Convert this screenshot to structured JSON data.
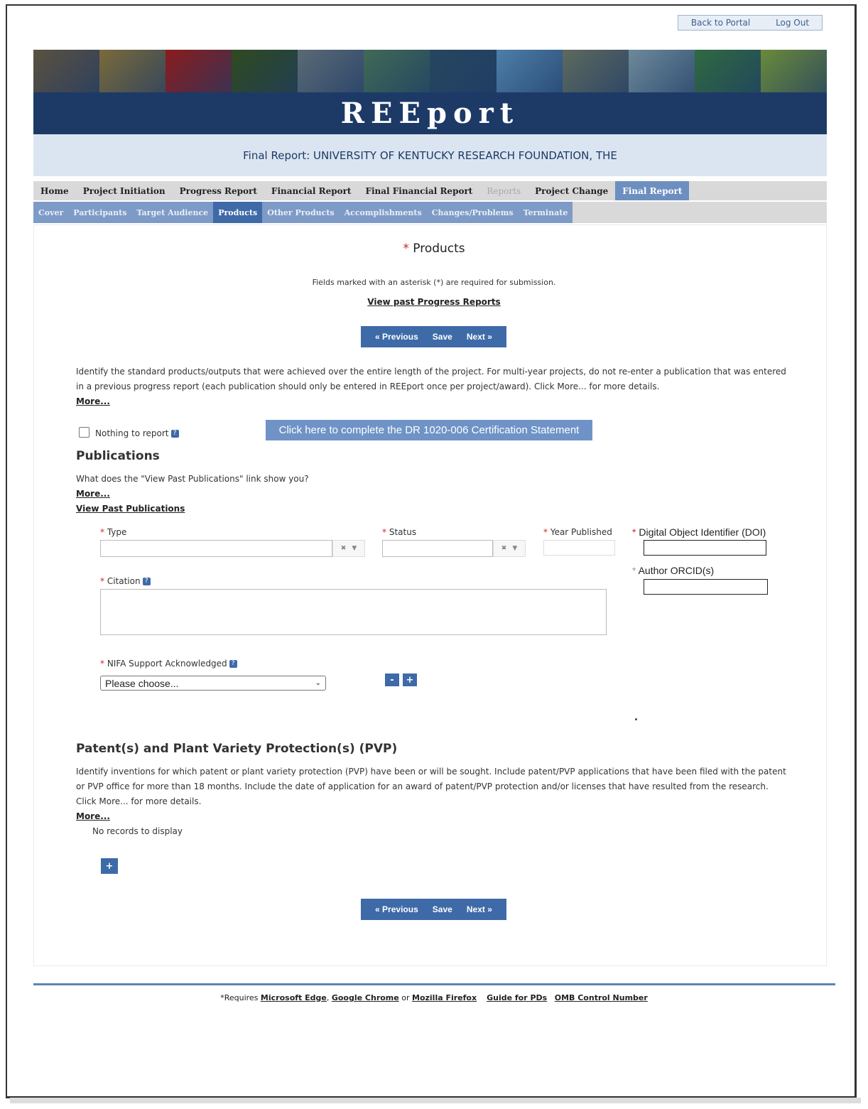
{
  "top_links": {
    "back": "Back to Portal",
    "logout": "Log Out"
  },
  "banner": {
    "title": "REEport",
    "photo_colors": [
      "#5b5140",
      "#7a6a3a",
      "#8a1c1c",
      "#2f4a1e",
      "#5a6a75",
      "#3f6a55",
      "#27465e",
      "#4d7fa8",
      "#5d6a5e",
      "#6d8a9a",
      "#2f6a40",
      "#6a8a3a"
    ]
  },
  "report_header": "Final Report: UNIVERSITY OF KENTUCKY RESEARCH FOUNDATION, THE",
  "nav_main": [
    {
      "label": "Home",
      "state": "normal"
    },
    {
      "label": "Project Initiation",
      "state": "normal"
    },
    {
      "label": "Progress Report",
      "state": "normal"
    },
    {
      "label": "Financial Report",
      "state": "normal"
    },
    {
      "label": "Final Financial Report",
      "state": "normal"
    },
    {
      "label": "Reports",
      "state": "disabled"
    },
    {
      "label": "Project Change",
      "state": "normal"
    },
    {
      "label": "Final Report",
      "state": "active"
    }
  ],
  "nav_sub": [
    {
      "label": "Cover",
      "state": "normal"
    },
    {
      "label": "Participants",
      "state": "normal"
    },
    {
      "label": "Target Audience",
      "state": "normal"
    },
    {
      "label": "Products",
      "state": "active"
    },
    {
      "label": "Other Products",
      "state": "normal"
    },
    {
      "label": "Accomplishments",
      "state": "normal"
    },
    {
      "label": "Changes/Problems",
      "state": "normal"
    },
    {
      "label": "Terminate",
      "state": "normal"
    }
  ],
  "page": {
    "asterisk": "*",
    "title": "Products",
    "required_note": "Fields marked with an asterisk (*) are required for submission.",
    "past_reports_link": "View past Progress Reports"
  },
  "buttons": {
    "previous": "« Previous",
    "save": "Save",
    "next": "Next »"
  },
  "intro": {
    "text": "Identify the standard products/outputs that were achieved over the entire length of the project. For multi-year projects, do not re-enter a publication that was entered in a previous progress report (each publication should only be entered in REEport once per project/award). Click More... for more details.",
    "more": "More..."
  },
  "nothing_to_report": "Nothing to report",
  "help_glyph": "?",
  "certification_button": "Click here to complete the DR 1020-006 Certification Statement",
  "publications": {
    "title": "Publications",
    "question": "What does the \"View Past Publications\" link show you?",
    "more": "More...",
    "view_past": "View Past Publications",
    "type_label": "Type",
    "status_label": "Status",
    "year_label": "Year Published",
    "doi_label": "Digital Object Identifier (DOI)",
    "orcid_label": "Author ORCID(s)",
    "citation_label": "Citation",
    "nifa_label": "NIFA Support Acknowledged",
    "nifa_selected": "Please choose...",
    "clear_glyph": "✖",
    "dropdown_glyph": "▼",
    "remove_glyph": "-",
    "add_glyph": "+"
  },
  "patents": {
    "title": "Patent(s) and Plant Variety Protection(s) (PVP)",
    "text": "Identify inventions for which patent or plant variety protection (PVP) have been or will be sought. Include patent/PVP applications that have been filed with the patent or PVP office for more than 18 months. Include the date of application for an award of patent/PVP protection and/or licenses that have resulted from the research. Click More... for more details.",
    "more": "More...",
    "empty": "No records to display",
    "add_glyph": "+"
  },
  "footer": {
    "prefix": "*Requires",
    "edge": "Microsoft Edge",
    "comma": ",",
    "chrome": "Google Chrome",
    "or": "or",
    "firefox": "Mozilla Firefox",
    "guide": "Guide for PDs",
    "omb": "OMB Control Number"
  },
  "colors": {
    "primary": "#3e6aa8",
    "header_dark": "#1d3a67",
    "required": "#d42222"
  }
}
